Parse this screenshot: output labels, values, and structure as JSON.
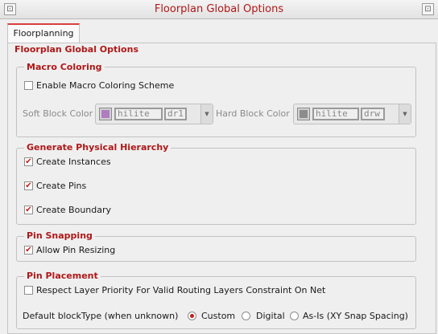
{
  "window": {
    "title": "Floorplan Global Options",
    "left_button_glyph": "⊡",
    "right_button_glyph": "⊡"
  },
  "tabs": [
    {
      "label": "Floorplanning",
      "active": true
    }
  ],
  "panel": {
    "title": "Floorplan Global Options"
  },
  "macro_coloring": {
    "title": "Macro Coloring",
    "enable": {
      "label": "Enable Macro Coloring Scheme",
      "checked": false
    },
    "soft_block": {
      "label": "Soft Block Color",
      "layer": "hilite",
      "purpose": "dr1",
      "swatch_color": "#b07cc0"
    },
    "hard_block": {
      "label": "Hard Block Color",
      "layer": "hilite",
      "purpose": "drw",
      "swatch_color": "#8c8c8c"
    }
  },
  "physical_hierarchy": {
    "title": "Generate Physical Hierarchy",
    "items": [
      {
        "label": "Create Instances",
        "checked": true
      },
      {
        "label": "Create Pins",
        "checked": true
      },
      {
        "label": "Create Boundary",
        "checked": true
      }
    ]
  },
  "pin_snapping": {
    "title": "Pin Snapping",
    "allow_resizing": {
      "label": "Allow Pin Resizing",
      "checked": true
    }
  },
  "pin_placement": {
    "title": "Pin Placement",
    "respect_priority": {
      "label": "Respect Layer Priority For Valid Routing Layers Constraint On Net",
      "checked": false
    },
    "block_type": {
      "label": "Default blockType (when unknown)",
      "options": [
        {
          "label": "Custom",
          "selected": true
        },
        {
          "label": "Digital",
          "selected": false
        },
        {
          "label": "As-Is (XY Snap Spacing)",
          "selected": false
        }
      ]
    }
  },
  "glyphs": {
    "check": "✔",
    "arrow": "▼"
  }
}
